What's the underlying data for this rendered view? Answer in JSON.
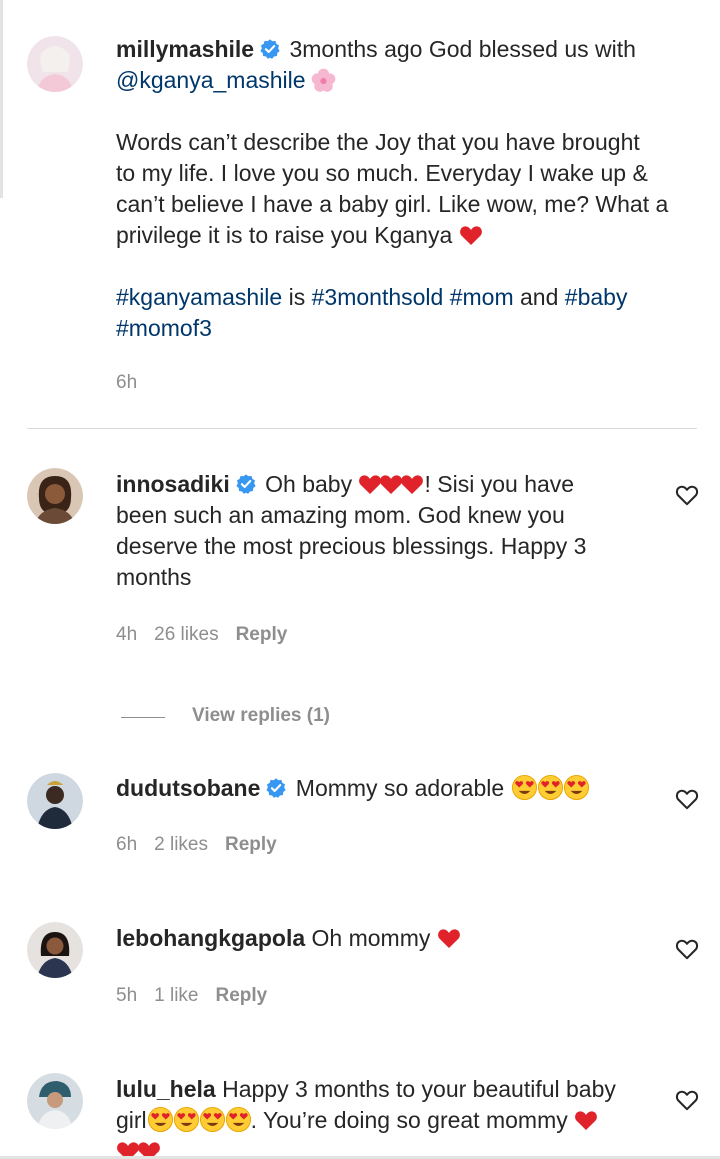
{
  "colors": {
    "text": "#262626",
    "link": "#00376b",
    "meta": "#8e8e8e",
    "verified": "#3897f0",
    "heart": "#e0232b"
  },
  "caption": {
    "username": "millymashile",
    "verified": true,
    "line1": "3months ago God blessed us with",
    "mention": "@kganya_mashile",
    "body_lines": [
      "Words can’t describe the Joy that you have brought",
      "to my life. I love you so much. Everyday I wake up &",
      "can’t believe I have a baby girl. Like wow, me? What a",
      "privilege it is to raise you Kganya"
    ],
    "tags_line1": [
      "#kganyamashile",
      "is",
      "#3monthsold",
      "#mom",
      "and",
      "#baby"
    ],
    "tags_line2": "#momof3",
    "time": "6h"
  },
  "comments": [
    {
      "username": "innosadiki",
      "verified": true,
      "text_before_hearts": "Oh baby",
      "text_lines": [
        "! Sisi you have",
        "been such an amazing mom. God knew you",
        "deserve the most precious blessings. Happy 3",
        "months"
      ],
      "time": "4h",
      "likes": "26 likes",
      "reply_label": "Reply",
      "view_replies": "View replies (1)"
    },
    {
      "username": "dudutsobane",
      "verified": true,
      "text": "Mommy so adorable",
      "time": "6h",
      "likes": "2 likes",
      "reply_label": "Reply"
    },
    {
      "username": "lebohangkgapola",
      "verified": false,
      "text": "Oh mommy",
      "time": "5h",
      "likes": "1 like",
      "reply_label": "Reply"
    },
    {
      "username": "lulu_hela",
      "verified": false,
      "text_line1": "Happy 3 months to your beautiful baby",
      "text_line2_prefix": "girl",
      "text_line2_suffix": ". You’re doing so great mommy"
    }
  ]
}
